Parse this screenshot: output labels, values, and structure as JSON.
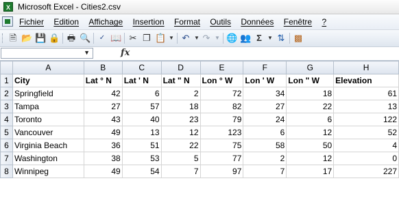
{
  "window": {
    "title": "Microsoft Excel - Cities2.csv",
    "app_icon_label": "X"
  },
  "menu": {
    "items": [
      "Fichier",
      "Edition",
      "Affichage",
      "Insertion",
      "Format",
      "Outils",
      "Données",
      "Fenêtre",
      "?"
    ]
  },
  "toolbar": {
    "icons": [
      "new-icon",
      "open-icon",
      "save-icon",
      "permission-icon",
      "print-icon",
      "print-preview-icon",
      "spelling-icon",
      "research-icon",
      "cut-icon",
      "copy-icon",
      "paste-icon",
      "undo-icon",
      "redo-icon",
      "hyperlink-icon",
      "share-icon",
      "autosum-icon",
      "sort-ascending-icon",
      "chart-icon"
    ]
  },
  "formula_bar": {
    "name_box": "",
    "fx": "fx",
    "formula": ""
  },
  "sheet": {
    "columns": [
      "A",
      "B",
      "C",
      "D",
      "E",
      "F",
      "G",
      "H"
    ],
    "rows": [
      {
        "n": "1",
        "cells": [
          "City",
          "Lat ° N",
          "Lat ' N",
          "Lat \" N",
          "Lon ° W",
          "Lon ' W",
          "Lon \" W",
          "Elevation"
        ]
      },
      {
        "n": "2",
        "cells": [
          "Springfield",
          "42",
          "6",
          "2",
          "72",
          "34",
          "18",
          "61"
        ]
      },
      {
        "n": "3",
        "cells": [
          "Tampa",
          "27",
          "57",
          "18",
          "82",
          "27",
          "22",
          "13"
        ]
      },
      {
        "n": "4",
        "cells": [
          "Toronto",
          "43",
          "40",
          "23",
          "79",
          "24",
          "6",
          "122"
        ]
      },
      {
        "n": "5",
        "cells": [
          "Vancouver",
          "49",
          "13",
          "12",
          "123",
          "6",
          "12",
          "52"
        ]
      },
      {
        "n": "6",
        "cells": [
          "Virginia Beach",
          "36",
          "51",
          "22",
          "75",
          "58",
          "50",
          "4"
        ]
      },
      {
        "n": "7",
        "cells": [
          "Washington",
          "38",
          "53",
          "5",
          "77",
          "2",
          "12",
          "0"
        ]
      },
      {
        "n": "8",
        "cells": [
          "Winnipeg",
          "49",
          "54",
          "7",
          "97",
          "7",
          "17",
          "227"
        ]
      }
    ]
  }
}
